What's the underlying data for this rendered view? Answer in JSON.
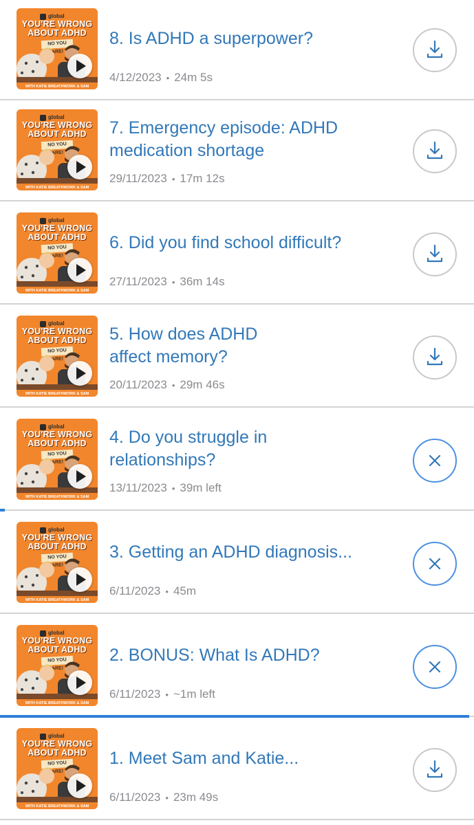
{
  "artwork": {
    "brand": "global",
    "show_title_line1": "YOU'RE WRONG",
    "show_title_line2": "ABOUT ADHD",
    "tag": "NO YOU ARE!",
    "footer": "WITH KATIE BREATHWORK &  SAM"
  },
  "colors": {
    "title": "#3278b8",
    "meta": "#8b8b90",
    "artwork_bg": "#f2862c",
    "progress": "#2f7fd6"
  },
  "episodes": [
    {
      "title": "8. Is ADHD a superpower?",
      "date": "4/12/2023",
      "duration": "24m 5s",
      "action": "download",
      "action_icon": "download-icon"
    },
    {
      "title": "7. Emergency episode: ADHD medication shortage",
      "date": "29/11/2023",
      "duration": "17m 12s",
      "action": "download",
      "action_icon": "download-icon"
    },
    {
      "title": "6. Did you find school difficult?",
      "date": "27/11/2023",
      "duration": "36m 14s",
      "action": "download",
      "action_icon": "download-icon"
    },
    {
      "title": "5. How does ADHD affect memory?",
      "date": "20/11/2023",
      "duration": "29m 46s",
      "action": "download",
      "action_icon": "download-icon"
    },
    {
      "title": "4. Do you struggle in relationships?",
      "date": "13/11/2023",
      "duration": "39m left",
      "action": "cancel",
      "action_icon": "close-icon",
      "progress": 0.01
    },
    {
      "title": "3. Getting an ADHD diagnosis...",
      "date": "6/11/2023",
      "duration": "45m",
      "action": "cancel",
      "action_icon": "close-icon"
    },
    {
      "title": "2. BONUS: What Is ADHD?",
      "date": "6/11/2023",
      "duration": "~1m left",
      "action": "cancel",
      "action_icon": "close-icon",
      "progress": 0.99
    },
    {
      "title": "1. Meet Sam and Katie...",
      "date": "6/11/2023",
      "duration": "23m 49s",
      "action": "download",
      "action_icon": "download-icon"
    }
  ],
  "meta_separator": "•"
}
